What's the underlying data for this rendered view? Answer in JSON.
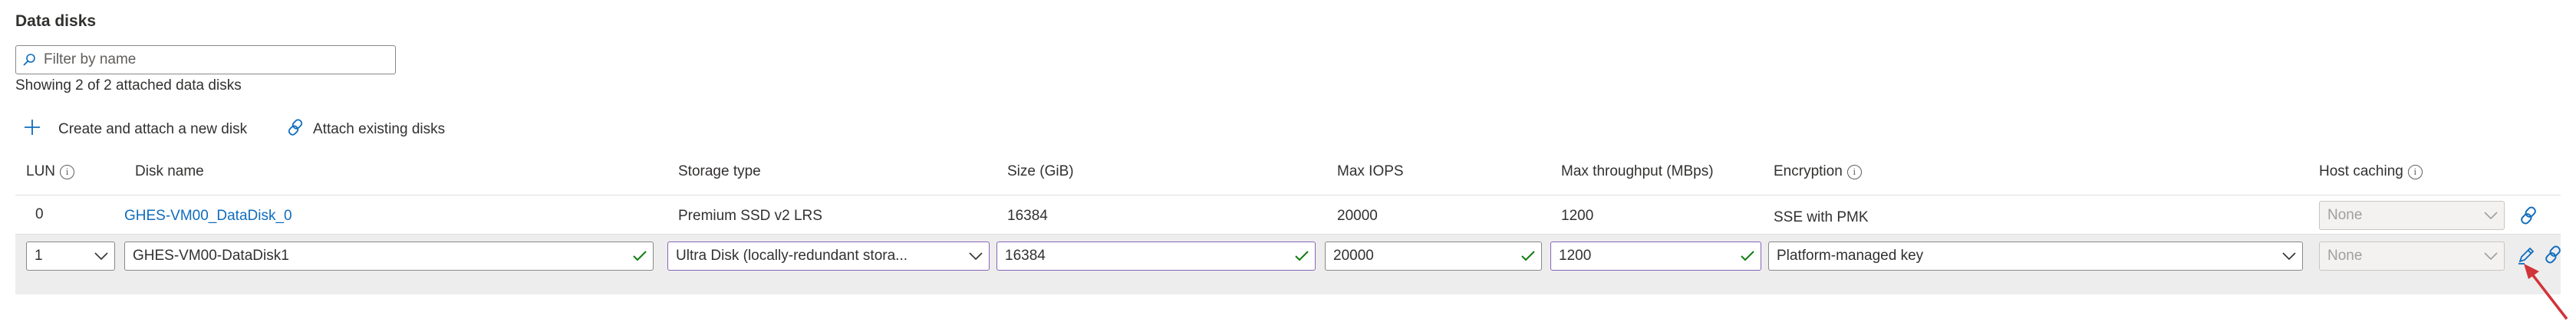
{
  "section": {
    "title": "Data disks"
  },
  "filter": {
    "placeholder": "Filter by name"
  },
  "summary": "Showing 2 of 2 attached data disks",
  "commands": {
    "create": "Create and attach a new disk",
    "attach": "Attach existing disks"
  },
  "columns": {
    "lun": "LUN",
    "disk_name": "Disk name",
    "storage_type": "Storage type",
    "size": "Size (GiB)",
    "max_iops": "Max IOPS",
    "max_throughput": "Max throughput (MBps)",
    "encryption": "Encryption",
    "host_caching": "Host caching"
  },
  "rows": [
    {
      "lun": "0",
      "disk_name": "GHES-VM00_DataDisk_0",
      "storage_type": "Premium SSD v2 LRS",
      "size": "16384",
      "max_iops": "20000",
      "max_throughput": "1200",
      "encryption": "SSE with PMK",
      "host_caching": "None"
    },
    {
      "lun": "1",
      "disk_name": "GHES-VM00-DataDisk1",
      "storage_type": "Ultra Disk (locally-redundant stora...",
      "size": "16384",
      "max_iops": "20000",
      "max_throughput": "1200",
      "encryption": "Platform-managed key",
      "host_caching": "None"
    }
  ],
  "colors": {
    "accent": "#0f6cbd",
    "valid_check": "#107c10",
    "valid_border": "#8764b8",
    "annotation_arrow": "#d13438",
    "selected_row_bg": "#ededed"
  }
}
